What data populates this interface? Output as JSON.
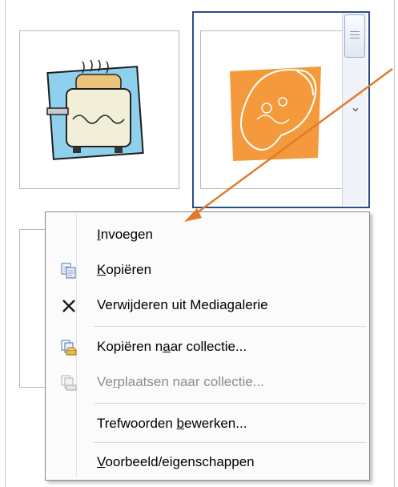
{
  "colors": {
    "selection_border": "#2b4c8c",
    "annotation_arrow": "#e07b2e",
    "orange_clip": "#f59a3c",
    "disabled_text": "#8c8c8c"
  },
  "gallery": {
    "items": [
      {
        "name": "toaster-clipart"
      },
      {
        "name": "cornucopia-clipart",
        "selected": true
      }
    ]
  },
  "context_menu": {
    "items": [
      {
        "pre": "",
        "u": "I",
        "post": "nvoegen",
        "icon": "none",
        "enabled": true
      },
      {
        "pre": "",
        "u": "K",
        "post": "opiëren",
        "icon": "copy-icon",
        "enabled": true
      },
      {
        "pre": "Verwi",
        "u": "j",
        "post": "deren uit Mediagalerie",
        "icon": "delete-x-icon",
        "enabled": true
      },
      {
        "pre": "Kopiëren n",
        "u": "a",
        "post": "ar collectie...",
        "icon": "copy-to-collection-icon",
        "enabled": true
      },
      {
        "pre": "Ve",
        "u": "r",
        "post": "plaatsen naar collectie...",
        "icon": "move-to-collection-icon",
        "enabled": false
      },
      {
        "pre": "Trefwoorden ",
        "u": "b",
        "post": "ewerken...",
        "icon": "none",
        "enabled": true
      },
      {
        "pre": "",
        "u": "V",
        "post": "oorbeeld/eigenschappen",
        "icon": "none",
        "enabled": true
      }
    ]
  }
}
